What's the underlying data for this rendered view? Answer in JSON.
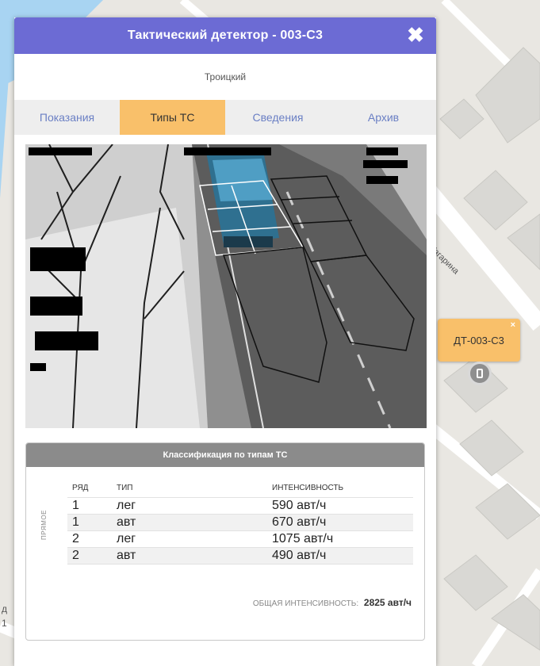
{
  "panel": {
    "title": "Тактический детектор - 003-С3",
    "subtitle": "Троицкий",
    "close_icon": "close-icon"
  },
  "tabs": [
    {
      "label": "Показания",
      "active": false
    },
    {
      "label": "Типы ТС",
      "active": true
    },
    {
      "label": "Сведения",
      "active": false
    },
    {
      "label": "Архив",
      "active": false
    }
  ],
  "classification": {
    "title": "Классификация по типам ТС",
    "side_label": "прямое",
    "headers": [
      "ряд",
      "тип",
      "интенсивность"
    ],
    "rows": [
      {
        "lane": "1",
        "type": "лег",
        "intensity": "590 авт/ч"
      },
      {
        "lane": "1",
        "type": "авт",
        "intensity": "670 авт/ч"
      },
      {
        "lane": "2",
        "type": "лег",
        "intensity": "1075 авт/ч"
      },
      {
        "lane": "2",
        "type": "авт",
        "intensity": "490 авт/ч"
      }
    ],
    "total_label": "ОБЩАЯ ИНТЕНСИВНОСТЬ:",
    "total_value": "2825 авт/ч"
  },
  "map": {
    "marker_label": "ДТ-003-С3",
    "street_label": "Гагарина"
  },
  "colors": {
    "header": "#6c6bd4",
    "active_tab": "#f9c06a",
    "tab_text": "#6a7fc4",
    "marker": "#f9c06a"
  }
}
